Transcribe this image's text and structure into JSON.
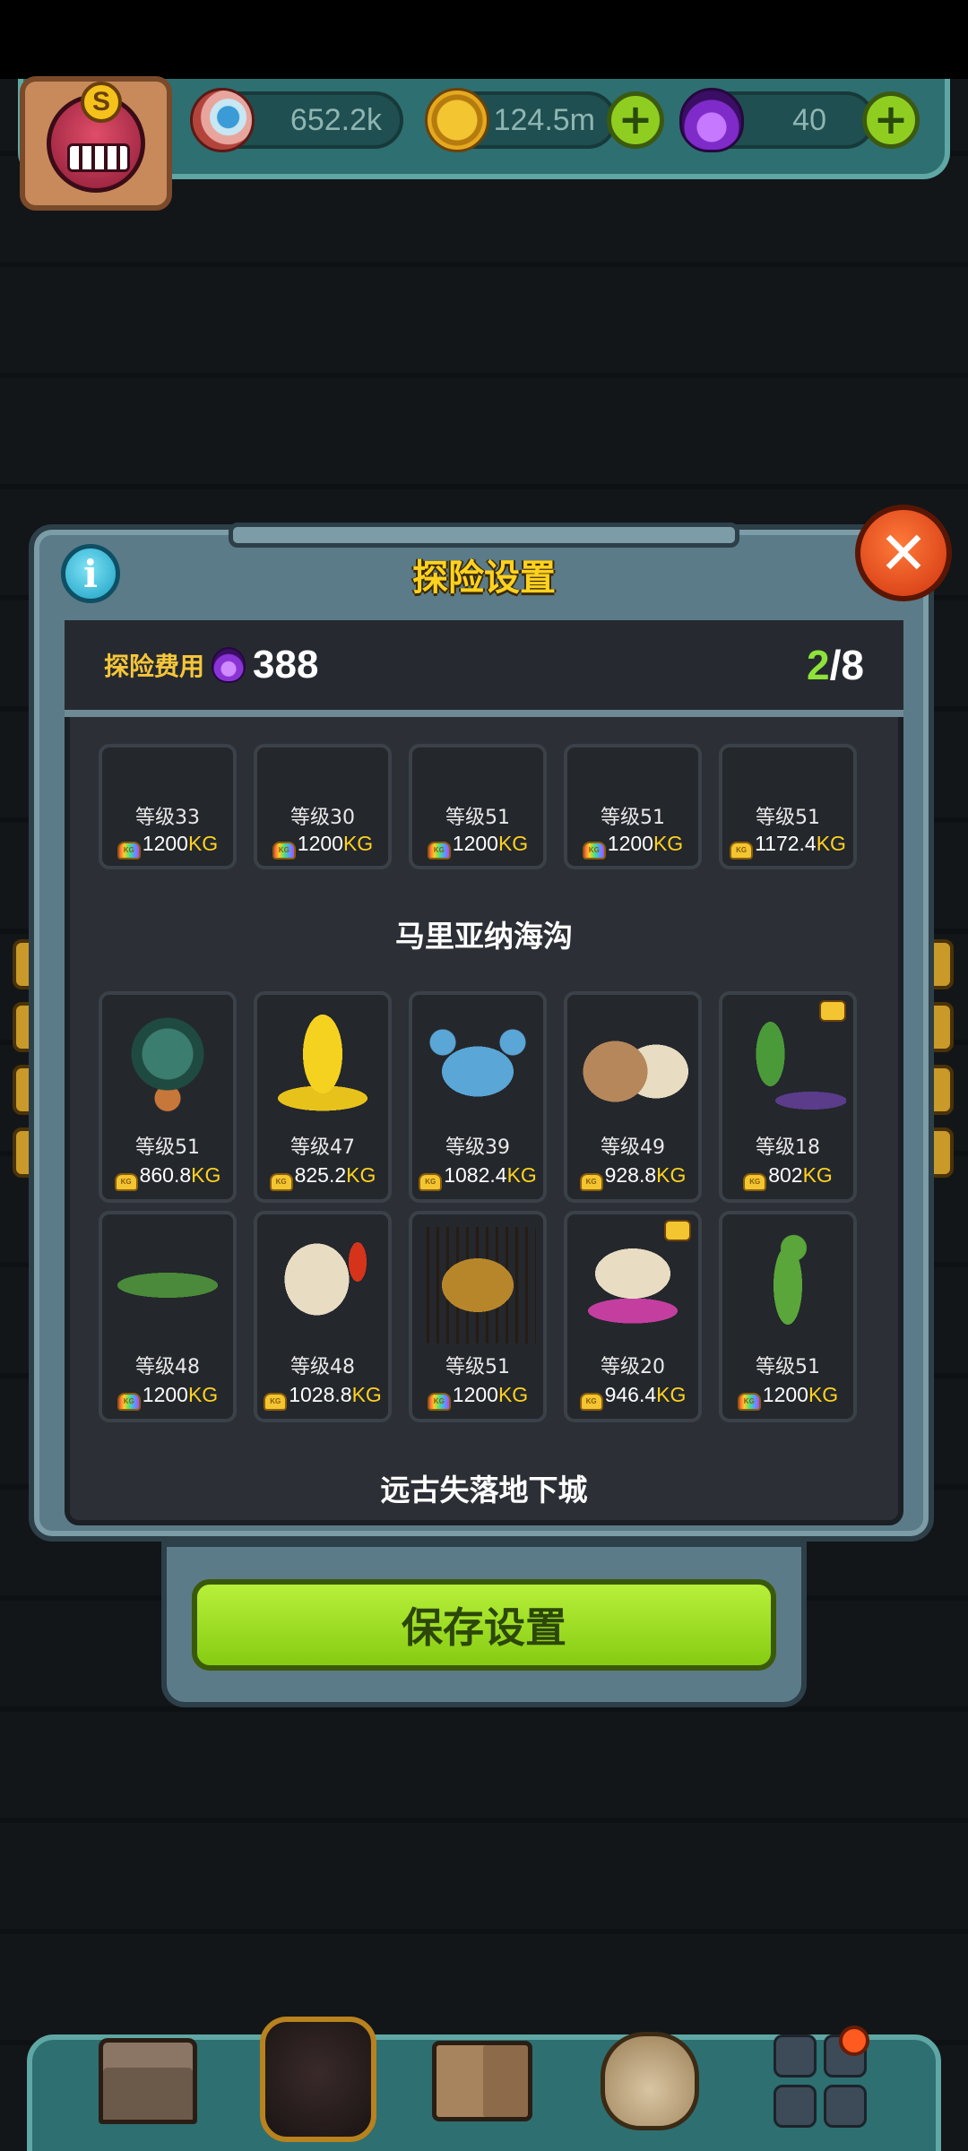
{
  "hud": {
    "eyes_value": "652.2k",
    "coins_value": "124.5m",
    "potions_value": "40",
    "avatar_badge": "S",
    "icons": [
      "eye-icon",
      "coin-icon",
      "potion-icon",
      "plus-icon"
    ]
  },
  "dialog": {
    "title": "探险设置",
    "info_symbol": "i",
    "close_symbol": "✕",
    "cost_label": "探险费用",
    "cost_value": "388",
    "selected_count": "2",
    "count_separator": "/",
    "max_count": "8"
  },
  "top_row": [
    {
      "level": "等级33",
      "weight": "1200",
      "unit": "KG",
      "icon": "rainbow"
    },
    {
      "level": "等级30",
      "weight": "1200",
      "unit": "KG",
      "icon": "rainbow"
    },
    {
      "level": "等级51",
      "weight": "1200",
      "unit": "KG",
      "icon": "rainbow"
    },
    {
      "level": "等级51",
      "weight": "1200",
      "unit": "KG",
      "icon": "rainbow"
    },
    {
      "level": "等级51",
      "weight": "1172.4",
      "unit": "KG",
      "icon": "gold"
    }
  ],
  "section_marina": {
    "title": "马里亚纳海沟",
    "cards": [
      {
        "name": "sea-urchin",
        "level": "等级51",
        "weight": "860.8",
        "unit": "KG",
        "icon": "gold",
        "tag": false
      },
      {
        "name": "yellow-squid",
        "level": "等级47",
        "weight": "825.2",
        "unit": "KG",
        "icon": "gold",
        "tag": false
      },
      {
        "name": "blue-crab",
        "level": "等级39",
        "weight": "1082.4",
        "unit": "KG",
        "icon": "gold",
        "tag": false
      },
      {
        "name": "walrus",
        "level": "等级49",
        "weight": "928.8",
        "unit": "KG",
        "icon": "gold",
        "tag": false
      },
      {
        "name": "mantis-centipede",
        "level": "等级18",
        "weight": "802",
        "unit": "KG",
        "icon": "gold",
        "tag": true
      },
      {
        "name": "green-eel",
        "level": "等级48",
        "weight": "1200",
        "unit": "KG",
        "icon": "rainbow",
        "tag": false
      },
      {
        "name": "clam-creature",
        "level": "等级48",
        "weight": "1028.8",
        "unit": "KG",
        "icon": "gold",
        "tag": false
      },
      {
        "name": "tiger-shrimp",
        "level": "等级51",
        "weight": "1200",
        "unit": "KG",
        "icon": "rainbow",
        "tag": false
      },
      {
        "name": "shell-jellyfish",
        "level": "等级20",
        "weight": "946.4",
        "unit": "KG",
        "icon": "gold",
        "tag": true
      },
      {
        "name": "seahorse",
        "level": "等级51",
        "weight": "1200",
        "unit": "KG",
        "icon": "rainbow",
        "tag": false
      }
    ]
  },
  "section_dungeon": {
    "title": "远古失落地下城"
  },
  "save_button": "保存设置",
  "colors": {
    "accent_green": "#8ee33a",
    "title_yellow": "#ffd21f",
    "panel": "#2c3036"
  }
}
